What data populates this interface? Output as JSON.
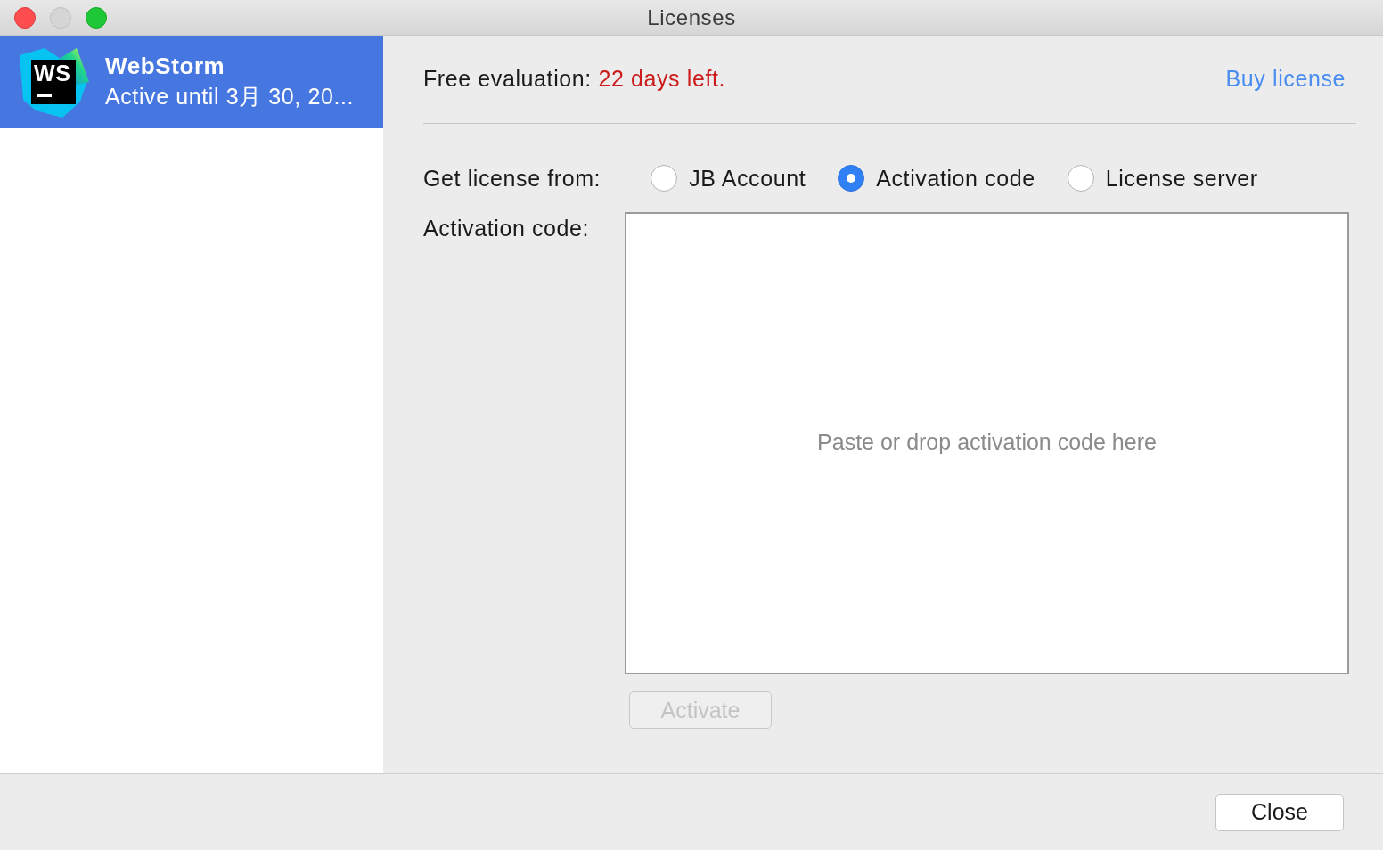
{
  "window": {
    "title": "Licenses"
  },
  "sidebar": {
    "items": [
      {
        "logo_text": "WS",
        "name": "WebStorm",
        "status": "Active until 3月 30, 20...",
        "selected": true
      }
    ]
  },
  "evaluation": {
    "label": "Free evaluation:",
    "remaining": "22 days left.",
    "buy_link": "Buy license"
  },
  "license_source": {
    "label": "Get license from:",
    "options": [
      {
        "label": "JB Account",
        "selected": false
      },
      {
        "label": "Activation code",
        "selected": true
      },
      {
        "label": "License server",
        "selected": false
      }
    ]
  },
  "activation_code": {
    "label": "Activation code:",
    "placeholder": "Paste or drop activation code here"
  },
  "activate_button": {
    "label": "Activate",
    "disabled": true
  },
  "close_button": {
    "label": "Close"
  }
}
